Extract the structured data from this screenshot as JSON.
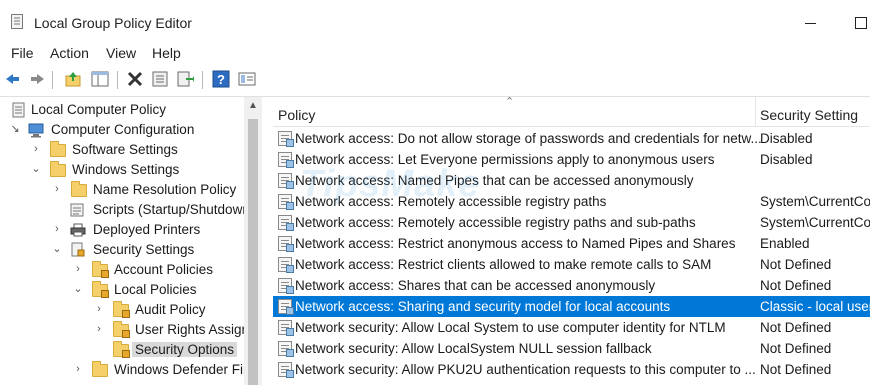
{
  "window": {
    "title": "Local Group Policy Editor"
  },
  "menu": [
    "File",
    "Action",
    "View",
    "Help"
  ],
  "toolbar_icons": [
    "back-icon",
    "forward-icon",
    "up-folder-icon",
    "show-hide-tree-icon",
    "delete-icon",
    "properties-icon",
    "export-list-icon",
    "help-icon",
    "view-icon"
  ],
  "tree": {
    "items": [
      {
        "label": "Local Computer Policy",
        "icon": "policy-icon",
        "expanded": true
      },
      {
        "label": "Computer Configuration",
        "icon": "computer-icon",
        "expanded": true
      },
      {
        "label": "Software Settings",
        "icon": "folder-icon",
        "expanded": false
      },
      {
        "label": "Windows Settings",
        "icon": "folder-icon",
        "expanded": true
      },
      {
        "label": "Name Resolution Policy",
        "icon": "folder-icon",
        "expanded": false
      },
      {
        "label": "Scripts (Startup/Shutdowr",
        "icon": "script-icon"
      },
      {
        "label": "Deployed Printers",
        "icon": "printer-icon",
        "expanded": false
      },
      {
        "label": "Security Settings",
        "icon": "security-icon",
        "expanded": true
      },
      {
        "label": "Account Policies",
        "icon": "lock-folder-icon",
        "expanded": false
      },
      {
        "label": "Local Policies",
        "icon": "lock-folder-icon",
        "expanded": true
      },
      {
        "label": "Audit Policy",
        "icon": "lock-folder-icon",
        "expanded": false
      },
      {
        "label": "User Rights Assign",
        "icon": "lock-folder-icon",
        "expanded": false
      },
      {
        "label": "Security Options",
        "icon": "lock-folder-icon",
        "selected": true
      },
      {
        "label": "Windows Defender Fir",
        "icon": "folder-icon",
        "expanded": false
      }
    ]
  },
  "list": {
    "columns": {
      "policy": "Policy",
      "setting": "Security Setting"
    },
    "rows": [
      {
        "policy": "Network access: Do not allow storage of passwords and credentials for netw...",
        "setting": "Disabled"
      },
      {
        "policy": "Network access: Let Everyone permissions apply to anonymous users",
        "setting": "Disabled"
      },
      {
        "policy": "Network access: Named Pipes that can be accessed anonymously",
        "setting": ""
      },
      {
        "policy": "Network access: Remotely accessible registry paths",
        "setting": "System\\CurrentCo"
      },
      {
        "policy": "Network access: Remotely accessible registry paths and sub-paths",
        "setting": "System\\CurrentCo"
      },
      {
        "policy": "Network access: Restrict anonymous access to Named Pipes and Shares",
        "setting": "Enabled"
      },
      {
        "policy": "Network access: Restrict clients allowed to make remote calls to SAM",
        "setting": "Not Defined"
      },
      {
        "policy": "Network access: Shares that can be accessed anonymously",
        "setting": "Not Defined"
      },
      {
        "policy": "Network access: Sharing and security model for local accounts",
        "setting": "Classic - local users",
        "selected": true
      },
      {
        "policy": "Network security: Allow Local System to use computer identity for NTLM",
        "setting": "Not Defined"
      },
      {
        "policy": "Network security: Allow LocalSystem NULL session fallback",
        "setting": "Not Defined"
      },
      {
        "policy": "Network security: Allow PKU2U authentication requests to this computer to ...",
        "setting": "Not Defined"
      }
    ]
  },
  "watermark": "TipsMake",
  "colors": {
    "selection": "#0078d7",
    "tree_selection": "#d9d9d9"
  }
}
